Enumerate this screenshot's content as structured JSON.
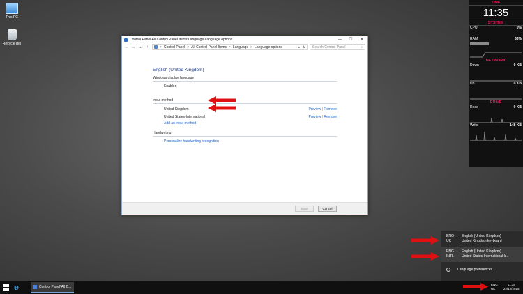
{
  "desktop": {
    "icons": [
      {
        "label": "This PC",
        "icon": "computer-icon"
      },
      {
        "label": "Recycle Bin",
        "icon": "recycle-bin-icon"
      }
    ]
  },
  "window": {
    "title": "Control Panel\\All Control Panel Items\\Language\\Language options",
    "controls": {
      "minimize": "—",
      "maximize": "☐",
      "close": "✕"
    },
    "address": {
      "crumbs": [
        "Control Panel",
        "All Control Panel Items",
        "Language",
        "Language options"
      ],
      "separator": ">",
      "search_placeholder": "Search Control Panel"
    },
    "heading": "English (United Kingdom)",
    "display_language": {
      "title": "Windows display language",
      "value": "Enabled"
    },
    "input_method": {
      "title": "Input method",
      "items": [
        {
          "name": "United Kingdom",
          "preview": "Preview",
          "remove": "Remove"
        },
        {
          "name": "United States-International",
          "preview": "Preview",
          "remove": "Remove"
        }
      ],
      "add_link": "Add an input method"
    },
    "handwriting": {
      "title": "Handwriting",
      "link": "Personalize handwriting recognition"
    },
    "buttons": {
      "save": "Save",
      "cancel": "Cancel"
    }
  },
  "gadget": {
    "time_header": "TIME",
    "time": "11:35",
    "system_header": "SYSTEM",
    "cpu_label": "CPU",
    "cpu_value": "0%",
    "ram_label": "RAM",
    "ram_value": "36%",
    "ram_fraction": 0.36,
    "network_header": "NETWORK",
    "down_label": "Down",
    "down_value": "0 KB",
    "up_label": "Up",
    "up_value": "0 KB",
    "drive_header": "DRIVE",
    "read_label": "Read",
    "read_value": "0 KB",
    "write_label": "Write",
    "write_value": "148 KB",
    "accent_color": "#e8185c"
  },
  "language_flyout": {
    "items": [
      {
        "code": "ENG",
        "sub": "UK",
        "name": "English (United Kingdom)",
        "keyboard": "United Kingdom keyboard"
      },
      {
        "code": "ENG",
        "sub": "INTL",
        "name": "English (United Kingdom)",
        "keyboard": "United States-International k..."
      }
    ],
    "preferences": "Language preferences"
  },
  "taskbar": {
    "task_label": "Control Panel\\All C...",
    "tray_lang": "ENG",
    "tray_lang_sub": "UK",
    "tray_time": "11:35",
    "tray_date": "22/12/2015"
  },
  "annotation_color": "#e01010"
}
